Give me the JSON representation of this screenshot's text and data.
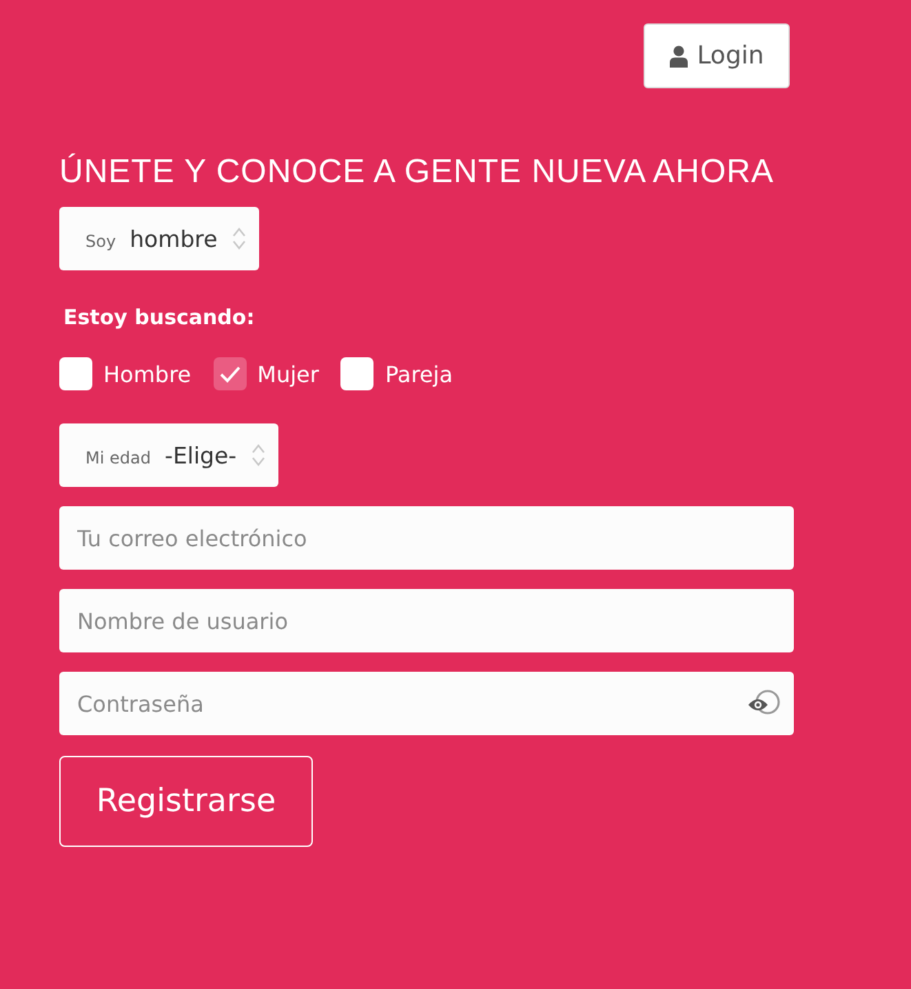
{
  "login_button": {
    "label": "Login"
  },
  "title": "ÚNETE Y CONOCE A GENTE NUEVA AHORA",
  "gender_select": {
    "label": "Soy",
    "value": "hombre"
  },
  "seeking": {
    "label": "Estoy buscando:",
    "options": [
      {
        "label": "Hombre",
        "checked": false
      },
      {
        "label": "Mujer",
        "checked": true
      },
      {
        "label": "Pareja",
        "checked": false
      }
    ]
  },
  "age_select": {
    "label": "Mi edad",
    "value": "-Elige-"
  },
  "fields": [
    {
      "kind": "text",
      "placeholder": "Tu correo electrónico"
    },
    {
      "kind": "text",
      "placeholder": "Nombre de usuario"
    },
    {
      "kind": "password",
      "placeholder": "Contraseña"
    }
  ],
  "submit_button": {
    "label": "Registrarse"
  }
}
